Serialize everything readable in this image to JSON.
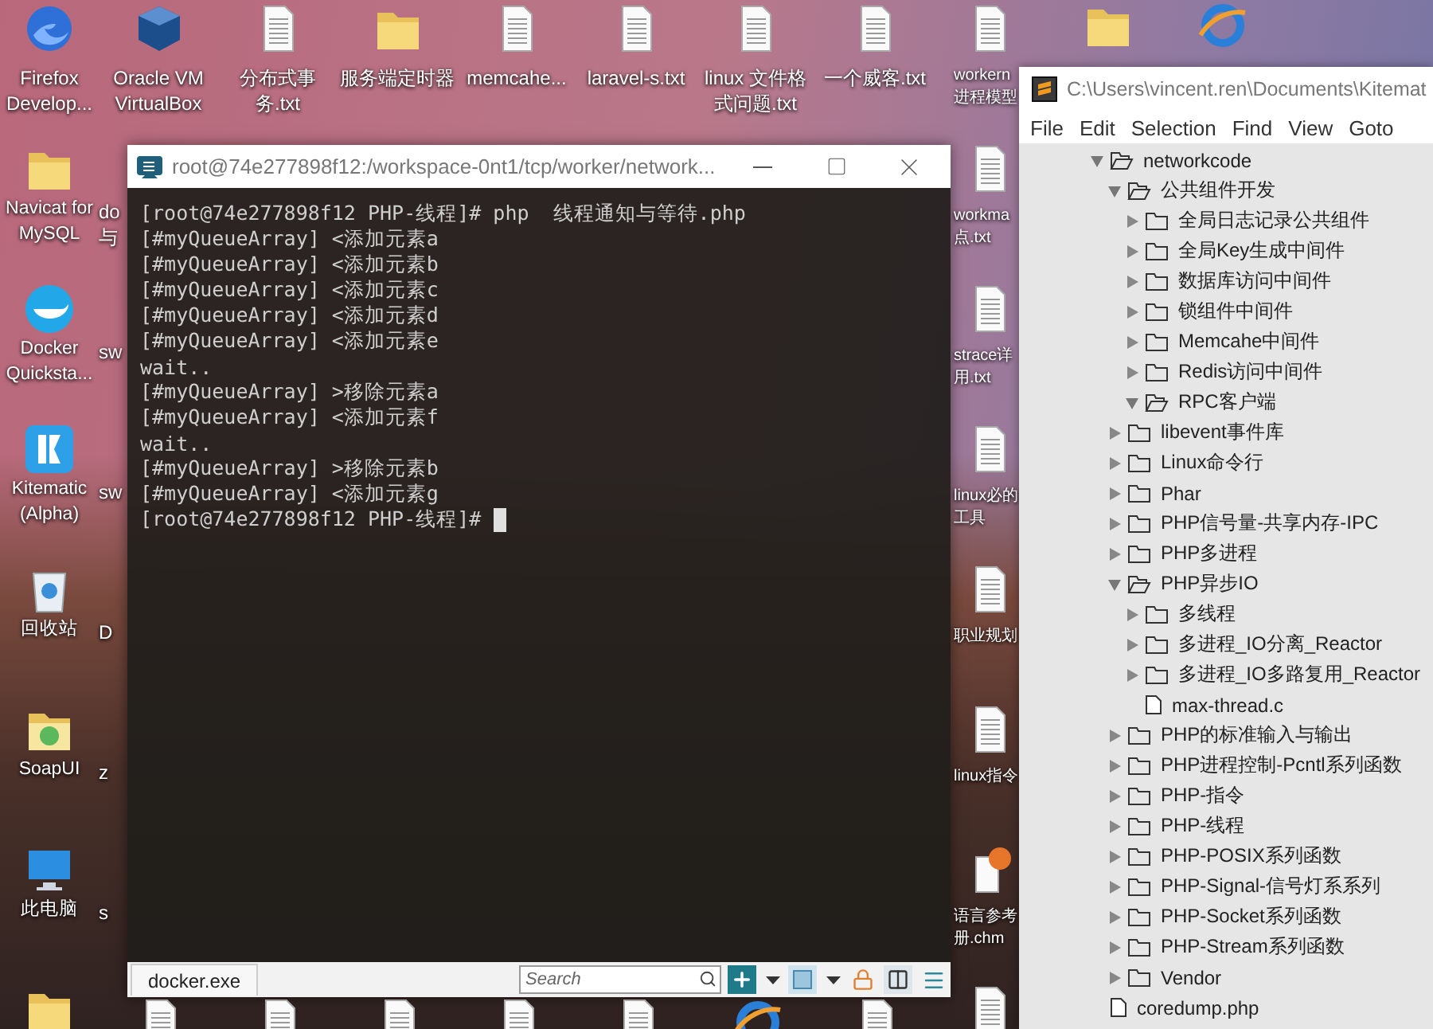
{
  "desktop": {
    "top_row": [
      {
        "label": "Firefox Develop...",
        "kind": "firefox"
      },
      {
        "label": "Oracle VM VirtualBox",
        "kind": "virtualbox"
      },
      {
        "label": "分布式事务.txt",
        "kind": "document"
      },
      {
        "label": "服务端定时器",
        "kind": "folder"
      },
      {
        "label": "memcahe...",
        "kind": "document"
      },
      {
        "label": "laravel-s.txt",
        "kind": "document"
      },
      {
        "label": "linux 文件格式问题.txt",
        "kind": "document"
      },
      {
        "label": "一个威客.txt",
        "kind": "document"
      },
      {
        "label": "workern 进程模型",
        "kind": "document"
      }
    ],
    "left_column": [
      {
        "label": "Navicat for MySQL",
        "kind": "folder"
      },
      {
        "label": "Docker Quicksta...",
        "kind": "docker"
      },
      {
        "label": "Kitematic (Alpha)",
        "kind": "kitematic"
      },
      {
        "label": "回收站",
        "kind": "recycle"
      },
      {
        "label": "SoapUI",
        "kind": "soapui"
      },
      {
        "label": "此电脑",
        "kind": "computer"
      }
    ],
    "column_2": [
      "do 与",
      "sw",
      "sw",
      "D",
      "z",
      "s"
    ],
    "right_column": [
      {
        "label": "workma 点.txt",
        "kind": "document"
      },
      {
        "label": "strace详用.txt",
        "kind": "document"
      },
      {
        "label": "linux必的工具",
        "kind": "document"
      },
      {
        "label": "职业规划",
        "kind": "document"
      },
      {
        "label": "linux指令",
        "kind": "document"
      },
      {
        "label": "语言参考册.chm",
        "kind": "help"
      }
    ]
  },
  "terminal": {
    "title": "root@74e277898f12:/workspace-0nt1/tcp/worker/network...",
    "lines": [
      "[root@74e277898f12 PHP-线程]# php  线程通知与等待.php",
      "[#myQueueArray] <添加元素a",
      "[#myQueueArray] <添加元素b",
      "[#myQueueArray] <添加元素c",
      "[#myQueueArray] <添加元素d",
      "[#myQueueArray] <添加元素e",
      "wait..",
      "[#myQueueArray] >移除元素a",
      "[#myQueueArray] <添加元素f",
      "wait..",
      "[#myQueueArray] >移除元素b",
      "[#myQueueArray] <添加元素g",
      "[root@74e277898f12 PHP-线程]# "
    ],
    "status_bar": {
      "tab": "docker.exe",
      "search_placeholder": "Search"
    }
  },
  "editor": {
    "title": "C:\\Users\\vincent.ren\\Documents\\Kitemat",
    "menu": [
      "File",
      "Edit",
      "Selection",
      "Find",
      "View",
      "Goto"
    ],
    "tree": [
      {
        "name": "networkcode",
        "kind": "folder",
        "expanded": true,
        "children": [
          {
            "name": "公共组件开发",
            "kind": "folder",
            "expanded": true,
            "children": [
              {
                "name": "全局日志记录公共组件",
                "kind": "folder",
                "expanded": false
              },
              {
                "name": "全局Key生成中间件",
                "kind": "folder",
                "expanded": false
              },
              {
                "name": "数据库访问中间件",
                "kind": "folder",
                "expanded": false
              },
              {
                "name": "锁组件中间件",
                "kind": "folder",
                "expanded": false
              },
              {
                "name": "Memcahe中间件",
                "kind": "folder",
                "expanded": false
              },
              {
                "name": "Redis访问中间件",
                "kind": "folder",
                "expanded": false
              },
              {
                "name": "RPC客户端",
                "kind": "folder",
                "expanded": true
              }
            ]
          },
          {
            "name": "libevent事件库",
            "kind": "folder",
            "expanded": false
          },
          {
            "name": "Linux命令行",
            "kind": "folder",
            "expanded": false
          },
          {
            "name": "Phar",
            "kind": "folder",
            "expanded": false
          },
          {
            "name": "PHP信号量-共享内存-IPC",
            "kind": "folder",
            "expanded": false
          },
          {
            "name": "PHP多进程",
            "kind": "folder",
            "expanded": false
          },
          {
            "name": "PHP异步IO",
            "kind": "folder",
            "expanded": true,
            "children": [
              {
                "name": "多线程",
                "kind": "folder",
                "expanded": false
              },
              {
                "name": "多进程_IO分离_Reactor",
                "kind": "folder",
                "expanded": false
              },
              {
                "name": "多进程_IO多路复用_Reactor",
                "kind": "folder",
                "expanded": false
              },
              {
                "name": "max-thread.c",
                "kind": "file"
              }
            ]
          },
          {
            "name": "PHP的标准输入与输出",
            "kind": "folder",
            "expanded": false
          },
          {
            "name": "PHP进程控制-Pcntl系列函数",
            "kind": "folder",
            "expanded": false
          },
          {
            "name": "PHP-指令",
            "kind": "folder",
            "expanded": false
          },
          {
            "name": "PHP-线程",
            "kind": "folder",
            "expanded": false
          },
          {
            "name": "PHP-POSIX系列函数",
            "kind": "folder",
            "expanded": false
          },
          {
            "name": "PHP-Signal-信号灯系系列",
            "kind": "folder",
            "expanded": false
          },
          {
            "name": "PHP-Socket系列函数",
            "kind": "folder",
            "expanded": false
          },
          {
            "name": "PHP-Stream系列函数",
            "kind": "folder",
            "expanded": false
          },
          {
            "name": "Vendor",
            "kind": "folder",
            "expanded": false
          }
        ]
      },
      {
        "name": "coredump.php",
        "kind": "file"
      }
    ]
  }
}
